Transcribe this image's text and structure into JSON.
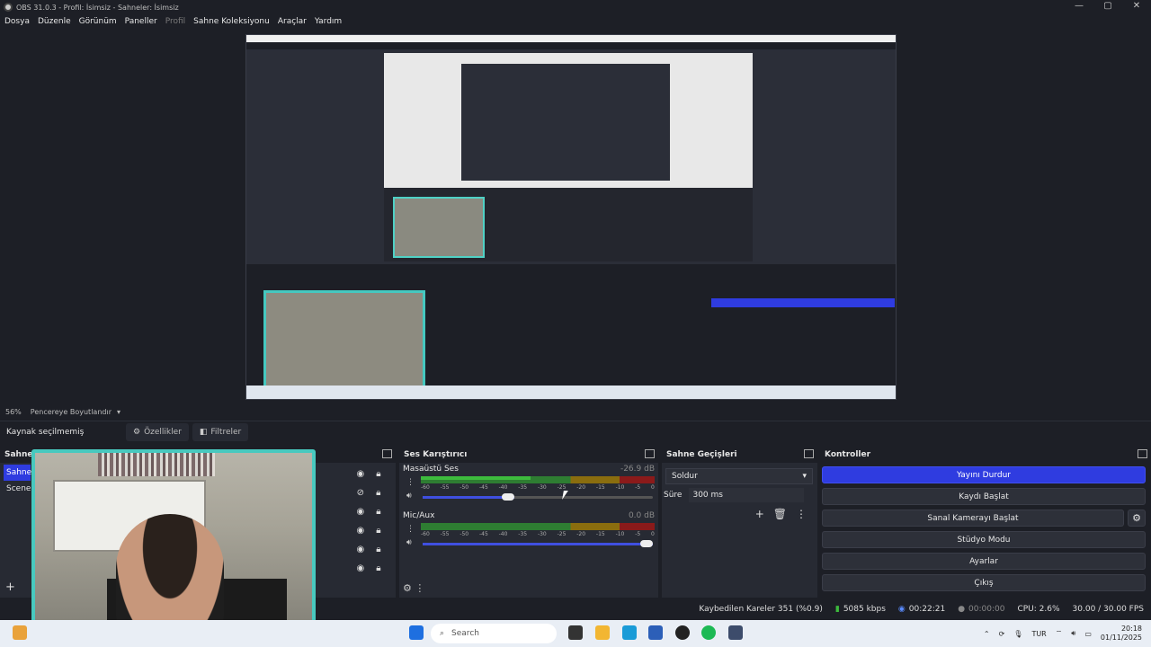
{
  "window": {
    "title": "OBS 31.0.3 - Profil: İsimsiz - Sahneler: İsimsiz",
    "controls": [
      "—",
      "▢",
      "✕"
    ]
  },
  "menu": [
    "Dosya",
    "Düzenle",
    "Görünüm",
    "Paneller",
    "Profil",
    "Sahne Koleksiyonu",
    "Araçlar",
    "Yardım"
  ],
  "preview": {
    "zoom": "56%",
    "fit_label": "Pencereye Boyutlandır"
  },
  "source_toolbar": {
    "no_source": "Kaynak seçilmemiş",
    "properties": "Özellikler",
    "filters": "Filtreler"
  },
  "scenes": {
    "title": "Sahnel",
    "items": [
      "Sahne",
      "Scene"
    ]
  },
  "mixer": {
    "title": "Ses Karıştırıcı",
    "channels": [
      {
        "name": "Masaüstü Ses",
        "db": "-26.9 dB",
        "level": 0.47,
        "volume": 0.4
      },
      {
        "name": "Mic/Aux",
        "db": "0.0 dB",
        "level": 0.0,
        "volume": 1.0
      }
    ],
    "scale": [
      "-60",
      "-55",
      "-50",
      "-45",
      "-40",
      "-35",
      "-30",
      "-25",
      "-20",
      "-15",
      "-10",
      "-5",
      "0"
    ]
  },
  "transitions": {
    "title": "Sahne Geçişleri",
    "selected": "Soldur",
    "duration_label": "Süre",
    "duration": "300 ms"
  },
  "controls": {
    "title": "Kontroller",
    "stop_stream": "Yayını Durdur",
    "start_rec": "Kaydı Başlat",
    "virtual_cam": "Sanal Kamerayı Başlat",
    "studio_mode": "Stüdyo Modu",
    "settings": "Ayarlar",
    "exit": "Çıkış"
  },
  "status": {
    "dropped": "Kaybedilen Kareler 351 (%0.9)",
    "bitrate": "5085 kbps",
    "stream_time": "00:22:21",
    "rec_time": "00:00:00",
    "cpu": "CPU: 2.6%",
    "fps": "30.00 / 30.00 FPS"
  },
  "taskbar": {
    "search": "Search",
    "lang": "TUR",
    "time": "20:18",
    "date": "01/11/2025"
  },
  "colors": {
    "accent": "#2f3ce0",
    "bg": "#1d1f26",
    "panel": "#272a33",
    "webcam_border": "#48c9bf"
  }
}
